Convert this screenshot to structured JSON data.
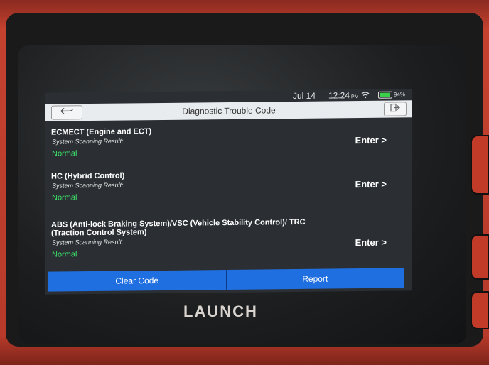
{
  "status_bar": {
    "date": "Jul 14",
    "time": "12:24",
    "time_suffix": "PM",
    "battery_percent": "94%"
  },
  "header": {
    "title": "Diagnostic Trouble Code"
  },
  "systems": [
    {
      "name": "ECMECT (Engine and ECT)",
      "scan_label": "System Scanning Result:",
      "status": "Normal",
      "enter_label": "Enter >"
    },
    {
      "name": "HC (Hybrid Control)",
      "scan_label": "System Scanning Result:",
      "status": "Normal",
      "enter_label": "Enter >"
    },
    {
      "name": "ABS (Anti-lock Braking System)/VSC (Vehicle Stability Control)/ TRC (Traction Control System)",
      "scan_label": "System Scanning Result:",
      "status": "Normal",
      "enter_label": "Enter >"
    }
  ],
  "footer": {
    "clear_code_label": "Clear Code",
    "report_label": "Report"
  },
  "brand": {
    "logo_text": "LAUNCH"
  },
  "colors": {
    "status_normal": "#3ce06a",
    "action_blue": "#1f6fe0",
    "casing_red": "#c4412e"
  },
  "icons": {
    "back": "back-arrow-icon",
    "exit": "exit-icon",
    "wifi": "wifi-icon",
    "battery": "battery-icon"
  }
}
